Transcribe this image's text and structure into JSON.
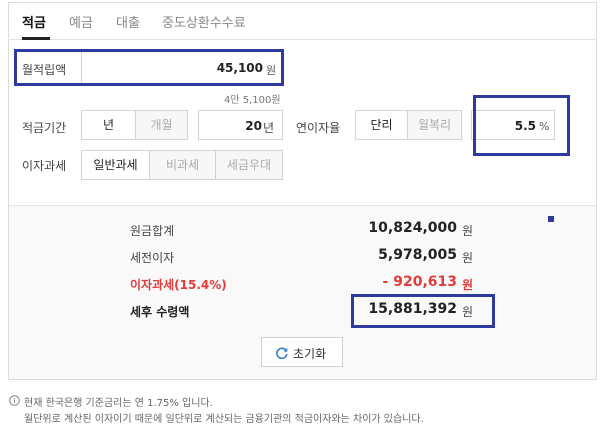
{
  "tabs": [
    {
      "label": "적금",
      "active": true
    },
    {
      "label": "예금",
      "active": false
    },
    {
      "label": "대출",
      "active": false
    },
    {
      "label": "중도상환수수료",
      "active": false
    }
  ],
  "form": {
    "monthly_deposit": {
      "label": "월적립액",
      "value": "45,100",
      "unit": "원",
      "hint": "4만 5,100원"
    },
    "period": {
      "label": "적금기간",
      "options": [
        "년",
        "개월"
      ],
      "selected": "년",
      "value": "20",
      "unit": "년"
    },
    "rate": {
      "label": "연이자율",
      "options": [
        "단리",
        "월복리"
      ],
      "selected": "단리",
      "value": "5.5",
      "unit": "%"
    },
    "tax": {
      "label": "이자과세",
      "options": [
        "일반과세",
        "비과세",
        "세금우대"
      ],
      "selected": "일반과세"
    }
  },
  "results": {
    "principal": {
      "label": "원금합계",
      "value": "10,824,000",
      "unit": "원"
    },
    "interest": {
      "label": "세전이자",
      "value": "5,978,005",
      "unit": "원"
    },
    "tax": {
      "label": "이자과세(15.4%)",
      "value": "- 920,613",
      "unit": "원"
    },
    "net": {
      "label": "세후 수령액",
      "value": "15,881,392",
      "unit": "원"
    }
  },
  "reset_label": "초기화",
  "notes": [
    "현재 한국은행 기준금리는 연 1.75% 입니다.",
    "월단위로 계산된 이자이기 때문에 일단위로 계산되는 금융기관의 적금이자와는 차이가 있습니다."
  ],
  "colors": {
    "highlight": "#2f3aa0",
    "negative": "#e23b3b"
  }
}
